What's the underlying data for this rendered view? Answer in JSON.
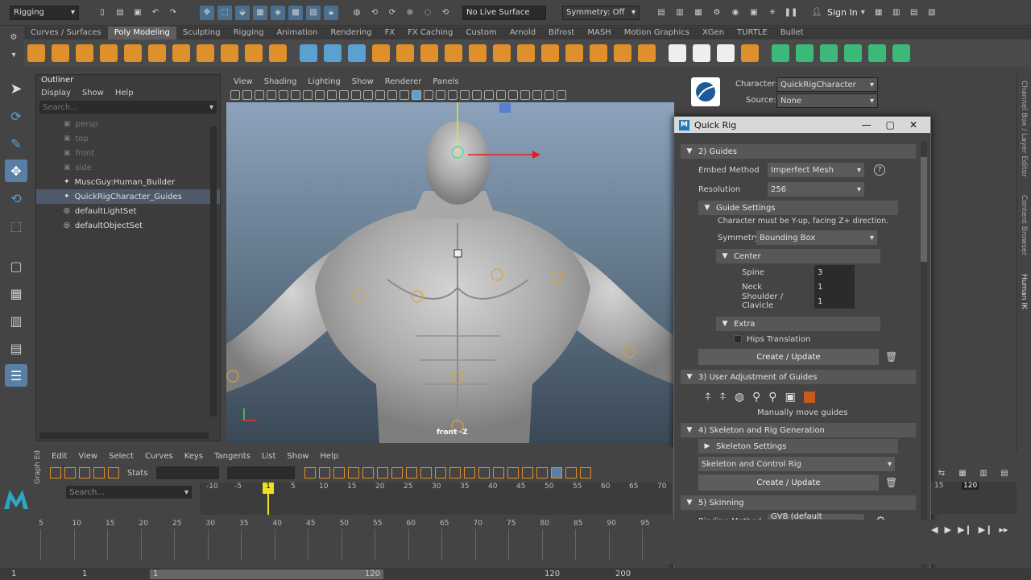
{
  "statusline": {
    "menu_set": "Rigging",
    "live_surface": "No Live Surface",
    "symmetry": "Symmetry: Off",
    "sign_in": "Sign In"
  },
  "shelf_tabs": [
    "Curves / Surfaces",
    "Poly Modeling",
    "Sculpting",
    "Rigging",
    "Animation",
    "Rendering",
    "FX",
    "FX Caching",
    "Custom",
    "Arnold",
    "Bifrost",
    "MASH",
    "Motion Graphics",
    "XGen",
    "TURTLE",
    "Bullet"
  ],
  "shelf_active": "Poly Modeling",
  "outliner": {
    "title": "Outliner",
    "menus": [
      "Display",
      "Show",
      "Help"
    ],
    "search_placeholder": "Search...",
    "items": [
      {
        "label": "persp",
        "dim": true
      },
      {
        "label": "top",
        "dim": true
      },
      {
        "label": "front",
        "dim": true
      },
      {
        "label": "side",
        "dim": true
      },
      {
        "label": "MuscGuy:Human_Builder",
        "dim": false
      },
      {
        "label": "QuickRigCharacter_Guides",
        "dim": false
      },
      {
        "label": "defaultLightSet",
        "dim": false
      },
      {
        "label": "defaultObjectSet",
        "dim": false
      }
    ]
  },
  "viewport": {
    "menus": [
      "View",
      "Shading",
      "Lighting",
      "Show",
      "Renderer",
      "Panels"
    ],
    "camera_label": "front -Z"
  },
  "hik": {
    "character_label": "Character:",
    "character_value": "QuickRigCharacter",
    "source_label": "Source:",
    "source_value": "None"
  },
  "side_tabs": [
    "Channel Box / Layer Editor",
    "Content Browser",
    "Human IK"
  ],
  "quick_rig": {
    "title": "Quick Rig",
    "guides_header": "2) Guides",
    "embed_label": "Embed Method",
    "embed_value": "Imperfect Mesh",
    "resolution_label": "Resolution",
    "resolution_value": "256",
    "guide_settings": "Guide Settings",
    "guide_note": "Character must be Y-up, facing Z+ direction.",
    "symmetry_label": "Symmetry",
    "symmetry_value": "Bounding Box",
    "center_header": "Center",
    "spine_label": "Spine",
    "spine_value": "3",
    "neck_label": "Neck",
    "neck_value": "1",
    "shoulder_label": "Shoulder / Clavicle",
    "shoulder_value": "1",
    "extra_header": "Extra",
    "hips_label": "Hips Translation",
    "create_update": "Create / Update",
    "user_adjust_header": "3) User Adjustment of Guides",
    "manual_note": "Manually move guides",
    "skeleton_header": "4) Skeleton and Rig Generation",
    "skeleton_settings": "Skeleton Settings",
    "skeleton_mode": "Skeleton and Control Rig",
    "skinning_header": "5) Skinning",
    "binding_label": "Binding Method",
    "binding_value": "GVB (default settings)",
    "accent_color": "#c85a1e"
  },
  "graph_editor": {
    "side_label": "Graph Ed",
    "menus": [
      "Edit",
      "View",
      "Select",
      "Curves",
      "Keys",
      "Tangents",
      "List",
      "Show",
      "Help"
    ],
    "stats_label": "Stats",
    "search_placeholder": "Search...",
    "ruler_ticks": [
      "-10",
      "-5",
      "1",
      "5",
      "10",
      "15",
      "20",
      "25",
      "30",
      "35",
      "40",
      "45",
      "50",
      "55",
      "60",
      "65",
      "70"
    ],
    "current_frame": "1",
    "right_ticks": [
      "15",
      "120"
    ]
  },
  "timeline": {
    "ticks": [
      "5",
      "10",
      "15",
      "20",
      "25",
      "30",
      "35",
      "40",
      "45",
      "50",
      "55",
      "60",
      "65",
      "70",
      "75",
      "80",
      "85",
      "90",
      "95"
    ]
  },
  "range": {
    "start": "1",
    "start2": "1",
    "slider_start": "1",
    "slider_end": "120",
    "end": "120",
    "end2": "200"
  }
}
